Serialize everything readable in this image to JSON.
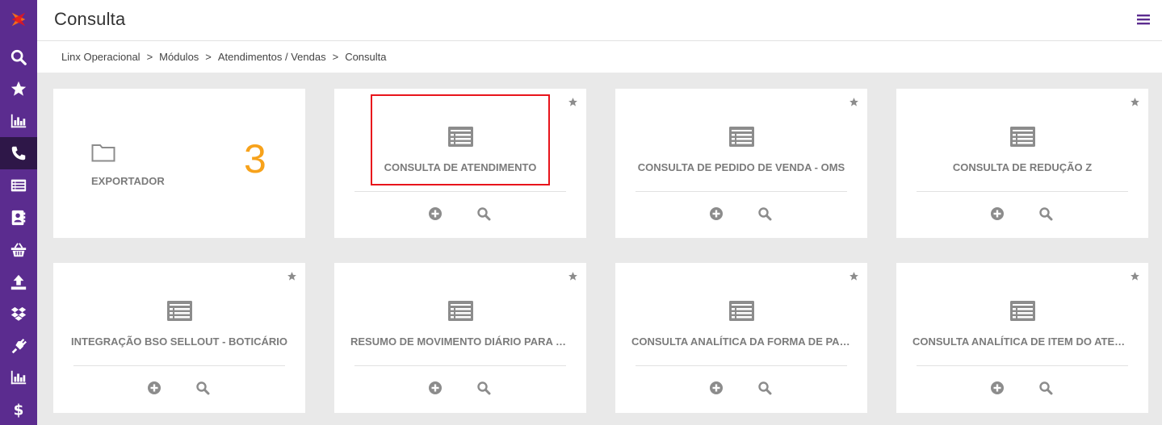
{
  "header": {
    "title": "Consulta"
  },
  "breadcrumb": [
    "Linx Operacional",
    "Módulos",
    "Atendimentos / Vendas",
    "Consulta"
  ],
  "breadcrumb_separator": ">",
  "sidebar": {
    "items": [
      {
        "icon": "logo-icon"
      },
      {
        "icon": "search-icon"
      },
      {
        "icon": "star-icon"
      },
      {
        "icon": "bar-chart-icon"
      },
      {
        "icon": "phone-icon",
        "active": true
      },
      {
        "icon": "list-icon"
      },
      {
        "icon": "contacts-icon"
      },
      {
        "icon": "basket-icon"
      },
      {
        "icon": "upload-icon"
      },
      {
        "icon": "dropbox-icon"
      },
      {
        "icon": "plug-icon"
      },
      {
        "icon": "bar-chart-icon"
      },
      {
        "icon": "dollar-icon"
      }
    ]
  },
  "exporter": {
    "label": "EXPORTADOR",
    "count": "3"
  },
  "cards": [
    {
      "title": "CONSULTA DE ATENDIMENTO",
      "highlighted": true
    },
    {
      "title": "CONSULTA DE PEDIDO DE VENDA - OMS"
    },
    {
      "title": "CONSULTA DE REDUÇÃO Z"
    },
    {
      "title": "INTEGRAÇÃO BSO SELLOUT - BOTICÁRIO"
    },
    {
      "title": "RESUMO DE MOVIMENTO DIÁRIO PARA SAT/..."
    },
    {
      "title": "CONSULTA ANALÍTICA DA FORMA DE PAGAM..."
    },
    {
      "title": "CONSULTA ANALÍTICA DE ITEM DO ATENDIME..."
    }
  ],
  "colors": {
    "sidebar": "#5b2c8f",
    "sidebar_active": "#2e1748",
    "accent_count": "#f7a21b",
    "highlight": "#e8141b",
    "icon_gray": "#8c8c8c"
  }
}
